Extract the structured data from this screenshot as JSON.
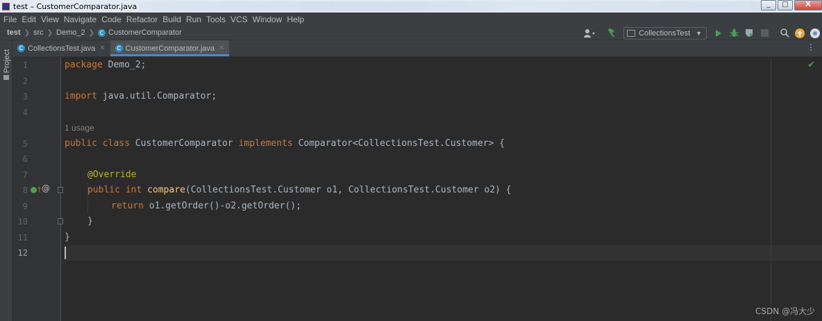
{
  "window": {
    "title": "test – CustomerComparator.java",
    "buttons": [
      "_",
      "□",
      "X"
    ]
  },
  "menu": [
    "File",
    "Edit",
    "View",
    "Navigate",
    "Code",
    "Refactor",
    "Build",
    "Run",
    "Tools",
    "VCS",
    "Window",
    "Help"
  ],
  "breadcrumb": [
    "test",
    "src",
    "Demo_2",
    "CustomerComparator"
  ],
  "toolbar": {
    "run_config": "CollectionsTest",
    "icons": [
      "user-icon",
      "hammer-icon",
      "run-icon",
      "debug-icon",
      "coverage-icon",
      "stop-icon",
      "search-icon",
      "update-icon",
      "logo-icon"
    ]
  },
  "sidebar": {
    "project_label": "Project"
  },
  "tabs": [
    {
      "label": "CollectionsTest.java",
      "active": false
    },
    {
      "label": "CustomerComparator.java",
      "active": true
    }
  ],
  "editor": {
    "line_numbers": [
      "1",
      "2",
      "3",
      "4",
      "5",
      "6",
      "7",
      "8",
      "9",
      "10",
      "11",
      "12"
    ],
    "usage_hint": "1 usage",
    "lines": {
      "l1_kw": "package",
      "l1_rest": " Demo_2;",
      "l3_kw": "import",
      "l3_rest": " java.util.Comparator;",
      "l5_kw1": "public class",
      "l5_name": " CustomerComparator ",
      "l5_kw2": "implements",
      "l5_rest": " Comparator<CollectionsTest.Customer> {",
      "l7_ann": "@Override",
      "l8_kw": "public int",
      "l8_fn": "compare",
      "l8_rest": "(CollectionsTest.Customer o1, CollectionsTest.Customer o2) {",
      "l9_kw": "return",
      "l9_rest": " o1.getOrder()-o2.getOrder();",
      "l10": "}",
      "l11": "}"
    },
    "current_line": "12"
  },
  "watermark": "CSDN @冯大少"
}
